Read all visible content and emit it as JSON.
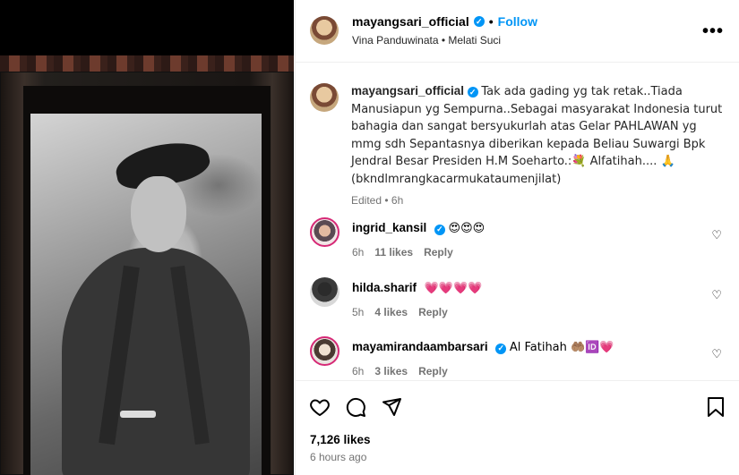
{
  "post": {
    "username": "mayangsari_official",
    "follow_label": "Follow",
    "separator": "•",
    "audio": "Vina Panduwinata • Melati Suci",
    "more_label": "•••"
  },
  "caption": {
    "username": "mayangsari_official",
    "text": "Tak ada gading yg tak retak..Tiada Manusiapun yg Sempurna..Sebagai masyarakat Indonesia turut bahagia dan sangat bersyukurlah atas Gelar PAHLAWAN yg mmg sdh Sepantasnya diberikan kepada Beliau Suwargi Bpk Jendral Besar Presiden H.M Soeharto.:💐 Alfatihah.... 🙏 (bkndlmrangkacarmukataumenjilat)",
    "edited": "Edited • 6h"
  },
  "comments": [
    {
      "user": "ingrid_kansil",
      "verified": true,
      "text": "😍😍😍",
      "time": "6h",
      "likes": "11 likes",
      "reply": "Reply"
    },
    {
      "user": "hilda.sharif",
      "verified": false,
      "text": "💗💗💗💗",
      "time": "5h",
      "likes": "4 likes",
      "reply": "Reply"
    },
    {
      "user": "mayamirandaambarsari",
      "verified": true,
      "text": "Al Fatihah 🤲🏽🆔💗",
      "time": "6h",
      "likes": "3 likes",
      "reply": "Reply"
    }
  ],
  "footer": {
    "likes": "7,126 likes",
    "time": "6 hours ago"
  },
  "colors": {
    "accent": "#0095f6",
    "muted": "#737373"
  }
}
